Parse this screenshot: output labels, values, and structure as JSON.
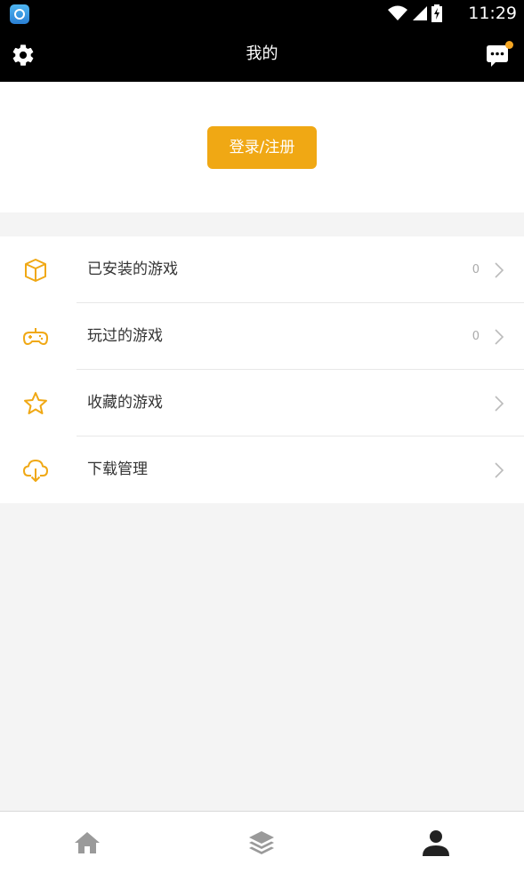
{
  "status_bar": {
    "time": "11:29"
  },
  "header": {
    "title": "我的"
  },
  "login": {
    "button_label": "登录/注册"
  },
  "menu": {
    "items": [
      {
        "label": "已安装的游戏",
        "count": "0",
        "icon": "box-icon"
      },
      {
        "label": "玩过的游戏",
        "count": "0",
        "icon": "gamepad-icon"
      },
      {
        "label": "收藏的游戏",
        "count": "",
        "icon": "star-icon"
      },
      {
        "label": "下载管理",
        "count": "",
        "icon": "cloud-download-icon"
      }
    ]
  },
  "tabbar": {
    "tabs": [
      {
        "icon": "home-icon",
        "active": false
      },
      {
        "icon": "layers-icon",
        "active": false
      },
      {
        "icon": "user-icon",
        "active": true
      }
    ]
  },
  "colors": {
    "accent": "#f0a814",
    "header_bg": "#000000",
    "page_bg": "#f4f4f4",
    "inactive_tab": "#9a9a9a",
    "active_tab": "#222222"
  }
}
